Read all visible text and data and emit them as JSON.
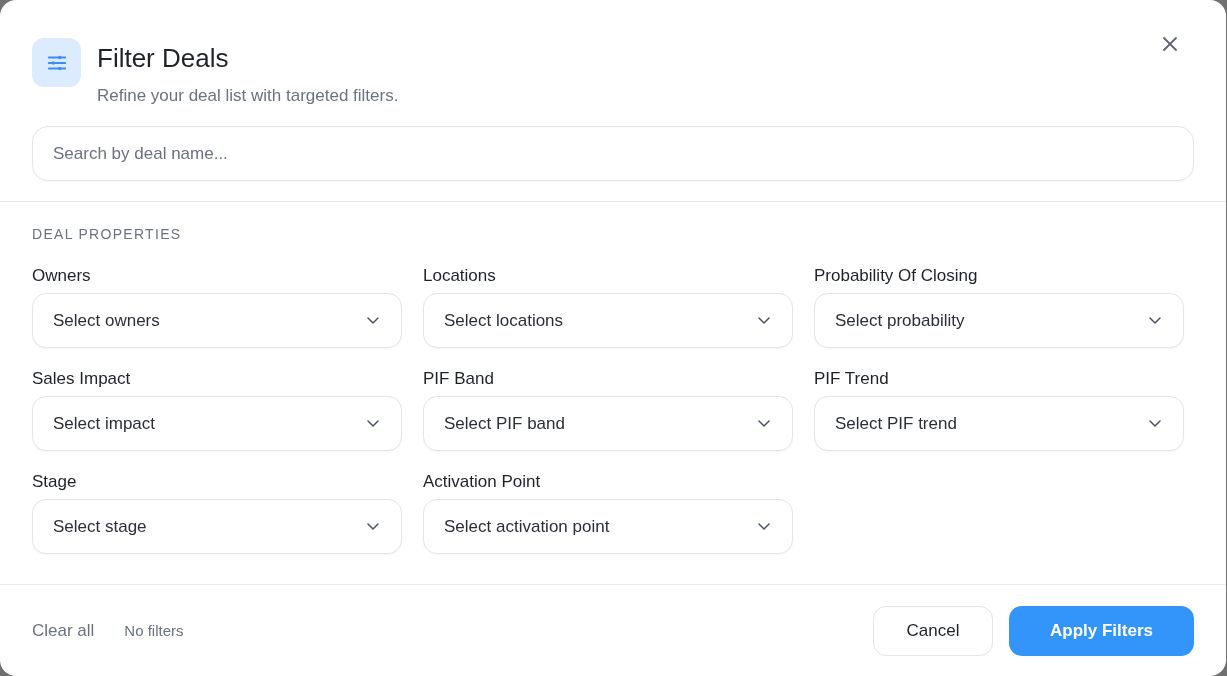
{
  "dialog": {
    "title": "Filter Deals",
    "subtitle": "Refine your deal list with targeted filters."
  },
  "search": {
    "placeholder": "Search by deal name..."
  },
  "section": {
    "heading": "DEAL PROPERTIES"
  },
  "filters": [
    {
      "label": "Owners",
      "placeholder": "Select owners"
    },
    {
      "label": "Locations",
      "placeholder": "Select locations"
    },
    {
      "label": "Probability Of Closing",
      "placeholder": "Select probability"
    },
    {
      "label": "Sales Impact",
      "placeholder": "Select impact"
    },
    {
      "label": "PIF Band",
      "placeholder": "Select PIF band"
    },
    {
      "label": "PIF Trend",
      "placeholder": "Select PIF trend"
    },
    {
      "label": "Stage",
      "placeholder": "Select stage"
    },
    {
      "label": "Activation Point",
      "placeholder": "Select activation point"
    }
  ],
  "footer": {
    "clear_link": "Clear all",
    "status": "No filters",
    "buttons": [
      {
        "label": "Cancel",
        "kind": "secondary"
      },
      {
        "label": "Apply Filters",
        "kind": "primary"
      }
    ]
  }
}
